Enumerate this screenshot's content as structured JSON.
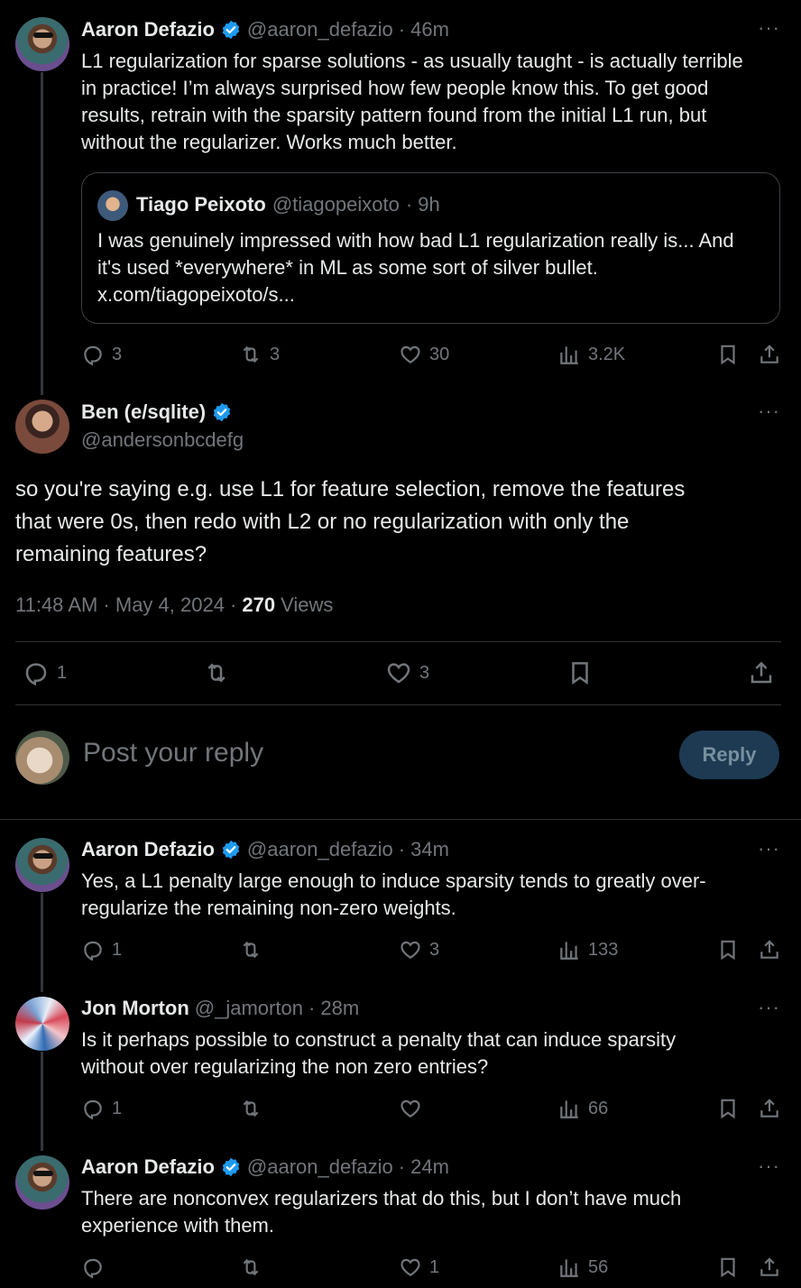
{
  "tweet1": {
    "name": "Aaron Defazio",
    "handle": "@aaron_defazio",
    "time": "· 46m",
    "text_lines": [
      "L1 regularization for sparse solutions - as usually taught - is actually terrible",
      "in practice! I’m always surprised how few people know this. To get good",
      "results, retrain with the sparsity pattern found from the initial L1 run, but",
      "without the regularizer. Works much better."
    ],
    "quote": {
      "name": "Tiago Peixoto",
      "handle": "@tiagopeixoto",
      "time": "· 9h",
      "text_lines": [
        "I was genuinely impressed with how bad L1 regularization really is... And",
        "it's used *everywhere* in ML as some sort of silver bullet.",
        "x.com/tiagopeixoto/s..."
      ]
    },
    "replies": "3",
    "reposts": "3",
    "likes": "30",
    "views": "3.2K"
  },
  "main_tweet": {
    "name": "Ben (e/sqlite)",
    "handle": "@andersonbcdefg",
    "text_lines": [
      "so you're saying e.g. use L1 for feature selection, remove the features",
      "that were 0s, then redo with L2 or no regularization with only the",
      "remaining features?"
    ],
    "time": "11:48 AM · May 4, 2024 ·",
    "views_count": "270",
    "views_label": "Views",
    "replies": "1",
    "likes": "3"
  },
  "reply_box": {
    "placeholder": "Post your reply",
    "button": "Reply"
  },
  "reply1": {
    "name": "Aaron Defazio",
    "handle": "@aaron_defazio",
    "time": "· 34m",
    "text_lines": [
      "Yes, a L1 penalty large enough to induce sparsity tends to greatly over-",
      "regularize the remaining non-zero weights."
    ],
    "replies": "1",
    "likes": "3",
    "views": "133"
  },
  "reply2": {
    "name": "Jon Morton",
    "handle": "@_jamorton",
    "time": "· 28m",
    "text_lines": [
      "Is it perhaps possible to construct a penalty that can induce sparsity",
      "without over regularizing the non zero entries?"
    ],
    "replies": "1",
    "views": "66"
  },
  "reply3": {
    "name": "Aaron Defazio",
    "handle": "@aaron_defazio",
    "time": "· 24m",
    "text_lines": [
      "There are nonconvex regularizers that do this, but I don’t have much",
      "experience with them."
    ],
    "likes": "1",
    "views": "56"
  },
  "colors": {
    "background": "#000000",
    "text": "#e7e9ea",
    "secondary": "#71767b",
    "verified": "#1d9bf0",
    "reply_button_bg": "#1d3a52"
  }
}
